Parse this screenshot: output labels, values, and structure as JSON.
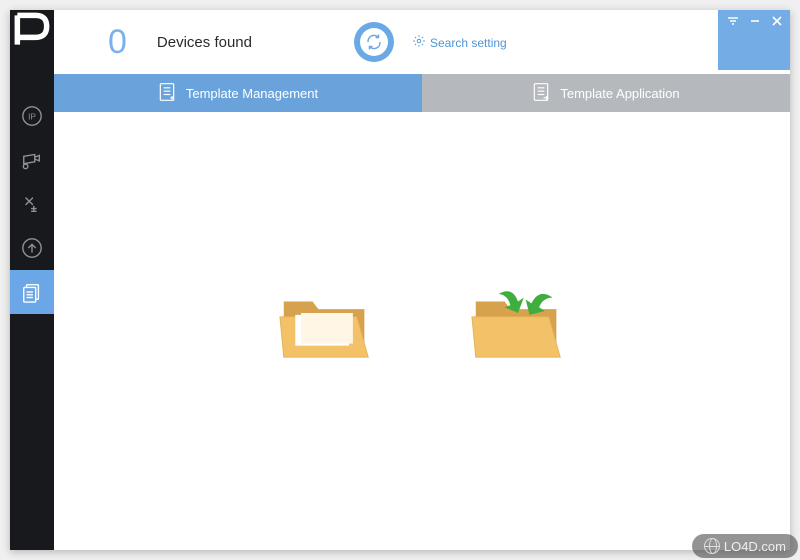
{
  "header": {
    "count": "0",
    "devices_label": "Devices found",
    "search_setting": "Search setting"
  },
  "sidebar": {
    "items": [
      {
        "name": "ip"
      },
      {
        "name": "camera-settings"
      },
      {
        "name": "tools"
      },
      {
        "name": "upgrade"
      },
      {
        "name": "templates"
      }
    ],
    "active_index": 4
  },
  "tabs": {
    "management": "Template Management",
    "application": "Template Application",
    "active": "management"
  },
  "folders": {
    "open": "Open template folder",
    "import": "Import/export template folder"
  },
  "window_controls": {
    "menu": "menu",
    "minimize": "minimize",
    "close": "close"
  },
  "watermark": "LO4D.com",
  "colors": {
    "accent": "#6aa3db",
    "sidebar": "#17191c",
    "tab_inactive": "#b5b9be",
    "count": "#78b2ec"
  }
}
